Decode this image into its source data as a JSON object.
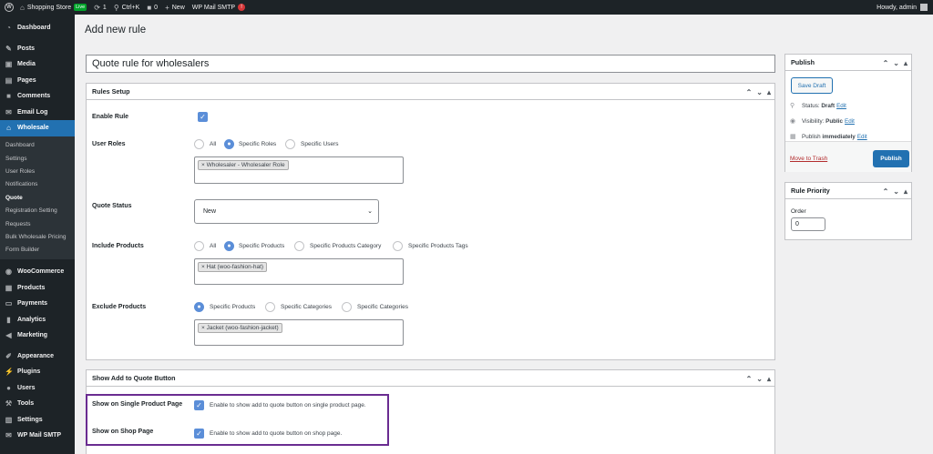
{
  "adminbar": {
    "site_name": "Shopping Store",
    "live_badge": "Live",
    "updates_count": "1",
    "shortcut": "Ctrl+K",
    "comments_count": "0",
    "new_label": "New",
    "smtp_label": "WP Mail SMTP",
    "smtp_notice": "!",
    "howdy": "Howdy, admin"
  },
  "sidebar": {
    "top_items": [
      {
        "label": "Dashboard",
        "icon": "dashboard-icon"
      },
      {
        "label": "Posts",
        "icon": "pin-icon"
      },
      {
        "label": "Media",
        "icon": "media-icon"
      },
      {
        "label": "Pages",
        "icon": "page-icon"
      },
      {
        "label": "Comments",
        "icon": "comment-icon"
      },
      {
        "label": "Email Log",
        "icon": "email-icon"
      },
      {
        "label": "Wholesale",
        "icon": "store-icon"
      }
    ],
    "submenu": [
      "Dashboard",
      "Settings",
      "User Roles",
      "Notifications",
      "Quote",
      "Registration Setting",
      "Requests",
      "Bulk Wholesale Pricing",
      "Form Builder"
    ],
    "bottom_items": [
      {
        "label": "WooCommerce",
        "icon": "woo-icon"
      },
      {
        "label": "Products",
        "icon": "box-icon"
      },
      {
        "label": "Payments",
        "icon": "payment-icon"
      },
      {
        "label": "Analytics",
        "icon": "chart-icon"
      },
      {
        "label": "Marketing",
        "icon": "megaphone-icon"
      },
      {
        "label": "Appearance",
        "icon": "brush-icon"
      },
      {
        "label": "Plugins",
        "icon": "plugin-icon"
      },
      {
        "label": "Users",
        "icon": "user-icon"
      },
      {
        "label": "Tools",
        "icon": "wrench-icon"
      },
      {
        "label": "Settings",
        "icon": "settings-icon"
      },
      {
        "label": "WP Mail SMTP",
        "icon": "mail-icon"
      }
    ]
  },
  "page": {
    "title": "Add new rule",
    "rule_title_value": "Quote rule for wholesalers"
  },
  "rules_setup": {
    "header": "Rules Setup",
    "enable_rule_label": "Enable Rule",
    "user_roles_label": "User Roles",
    "user_roles_options": [
      "All",
      "Specific Roles",
      "Specific Users"
    ],
    "user_roles_tag": "× Wholesaler - Wholesaler Role",
    "quote_status_label": "Quote Status",
    "quote_status_value": "New",
    "include_products_label": "Include Products",
    "include_options": [
      "All",
      "Specific Products",
      "Specific Products Category",
      "Specific Products Tags"
    ],
    "include_tag": "× Hat (woo-fashion-hat)",
    "exclude_products_label": "Exclude Products",
    "exclude_options": [
      "Specific Products",
      "Specific Categories",
      "Specific Categories"
    ],
    "exclude_tag": "× Jacket (woo-fashion-jacket)"
  },
  "show_quote": {
    "header": "Show Add to Quote Button",
    "single_label": "Show on Single Product Page",
    "single_desc": "Enable to show add to quote button on single product page.",
    "shop_label": "Show on Shop Page",
    "shop_desc": "Enable to show add to quote button on shop page."
  },
  "publish": {
    "header": "Publish",
    "save_draft": "Save Draft",
    "status_text": "Status:",
    "status_value": "Draft",
    "visibility_text": "Visibility:",
    "visibility_value": "Public",
    "publish_text": "Publish",
    "publish_value": "immediately",
    "edit": "Edit",
    "move_to_trash": "Move to Trash",
    "publish_button": "Publish"
  },
  "priority": {
    "header": "Rule Priority",
    "order_label": "Order",
    "order_value": "0"
  },
  "colors": {
    "accent": "#2271b1",
    "checkbox": "#5b8ed8",
    "highlight": "#6a2c91"
  }
}
